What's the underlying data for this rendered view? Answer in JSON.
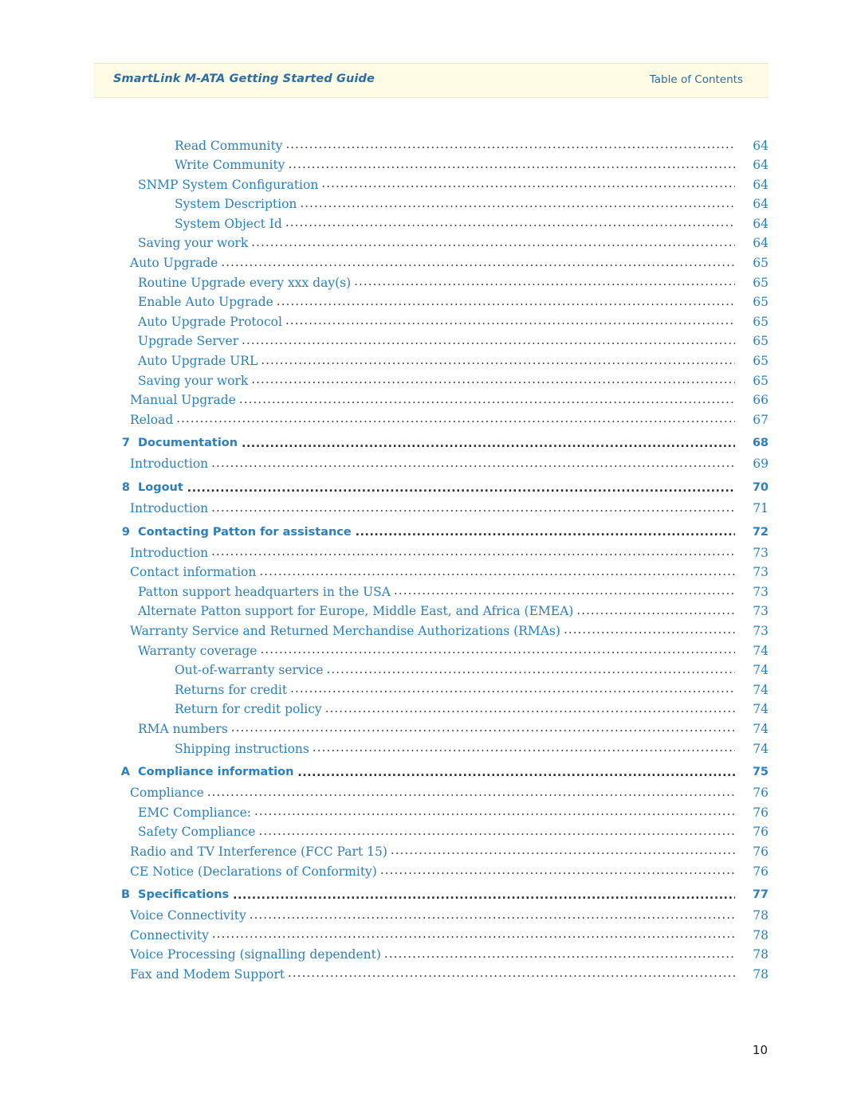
{
  "header": {
    "title": "SmartLink M-ATA Getting Started Guide",
    "section": "Table of Contents"
  },
  "footer": {
    "page_number": "10"
  },
  "toc": {
    "entries": [
      {
        "num": "",
        "label": "Read Community",
        "page": "64",
        "level": 2,
        "chapter": false
      },
      {
        "num": "",
        "label": "Write Community",
        "page": "64",
        "level": 2,
        "chapter": false
      },
      {
        "num": "",
        "label": "SNMP System Configuration",
        "page": "64",
        "level": 1,
        "chapter": false
      },
      {
        "num": "",
        "label": "System Description",
        "page": "64",
        "level": 2,
        "chapter": false
      },
      {
        "num": "",
        "label": "System Object Id",
        "page": "64",
        "level": 2,
        "chapter": false
      },
      {
        "num": "",
        "label": "Saving your work",
        "page": "64",
        "level": 1,
        "chapter": false
      },
      {
        "num": "",
        "label": "Auto Upgrade",
        "page": "65",
        "level": 0,
        "chapter": false
      },
      {
        "num": "",
        "label": "Routine Upgrade every xxx day(s)",
        "page": "65",
        "level": 1,
        "chapter": false
      },
      {
        "num": "",
        "label": "Enable Auto Upgrade",
        "page": "65",
        "level": 1,
        "chapter": false
      },
      {
        "num": "",
        "label": "Auto Upgrade Protocol",
        "page": "65",
        "level": 1,
        "chapter": false
      },
      {
        "num": "",
        "label": "Upgrade Server",
        "page": "65",
        "level": 1,
        "chapter": false
      },
      {
        "num": "",
        "label": "Auto Upgrade URL",
        "page": "65",
        "level": 1,
        "chapter": false
      },
      {
        "num": "",
        "label": "Saving your work",
        "page": "65",
        "level": 1,
        "chapter": false
      },
      {
        "num": "",
        "label": "Manual Upgrade",
        "page": "66",
        "level": 0,
        "chapter": false
      },
      {
        "num": "",
        "label": "Reload",
        "page": "67",
        "level": 0,
        "chapter": false
      },
      {
        "num": "7",
        "label": "Documentation",
        "page": "68",
        "level": 0,
        "chapter": true
      },
      {
        "num": "",
        "label": "Introduction",
        "page": "69",
        "level": 0,
        "chapter": false
      },
      {
        "num": "8",
        "label": "Logout",
        "page": "70",
        "level": 0,
        "chapter": true
      },
      {
        "num": "",
        "label": "Introduction",
        "page": "71",
        "level": 0,
        "chapter": false
      },
      {
        "num": "9",
        "label": "Contacting Patton for assistance",
        "page": "72",
        "level": 0,
        "chapter": true
      },
      {
        "num": "",
        "label": "Introduction",
        "page": "73",
        "level": 0,
        "chapter": false
      },
      {
        "num": "",
        "label": "Contact information",
        "page": "73",
        "level": 0,
        "chapter": false
      },
      {
        "num": "",
        "label": "Patton support headquarters in the USA",
        "page": "73",
        "level": 1,
        "chapter": false
      },
      {
        "num": "",
        "label": "Alternate Patton support for Europe, Middle East, and Africa (EMEA)",
        "page": "73",
        "level": 1,
        "chapter": false
      },
      {
        "num": "",
        "label": "Warranty Service and Returned Merchandise Authorizations (RMAs)",
        "page": "73",
        "level": 0,
        "chapter": false
      },
      {
        "num": "",
        "label": "Warranty coverage",
        "page": "74",
        "level": 1,
        "chapter": false
      },
      {
        "num": "",
        "label": "Out-of-warranty service",
        "page": "74",
        "level": 2,
        "chapter": false
      },
      {
        "num": "",
        "label": "Returns for credit",
        "page": "74",
        "level": 2,
        "chapter": false
      },
      {
        "num": "",
        "label": "Return for credit policy",
        "page": "74",
        "level": 2,
        "chapter": false
      },
      {
        "num": "",
        "label": "RMA numbers",
        "page": "74",
        "level": 1,
        "chapter": false
      },
      {
        "num": "",
        "label": "Shipping instructions",
        "page": "74",
        "level": 2,
        "chapter": false
      },
      {
        "num": "A",
        "label": "Compliance information",
        "page": "75",
        "level": 0,
        "chapter": true
      },
      {
        "num": "",
        "label": "Compliance",
        "page": "76",
        "level": 0,
        "chapter": false
      },
      {
        "num": "",
        "label": "EMC Compliance:",
        "page": "76",
        "level": 1,
        "chapter": false
      },
      {
        "num": "",
        "label": "Safety Compliance",
        "page": "76",
        "level": 1,
        "chapter": false
      },
      {
        "num": "",
        "label": "Radio and TV Interference (FCC Part 15)",
        "page": "76",
        "level": 0,
        "chapter": false
      },
      {
        "num": "",
        "label": "CE Notice (Declarations of Conformity)",
        "page": "76",
        "level": 0,
        "chapter": false
      },
      {
        "num": "B",
        "label": "Specifications",
        "page": "77",
        "level": 0,
        "chapter": true
      },
      {
        "num": "",
        "label": "Voice Connectivity",
        "page": "78",
        "level": 0,
        "chapter": false
      },
      {
        "num": "",
        "label": "Connectivity",
        "page": "78",
        "level": 0,
        "chapter": false
      },
      {
        "num": "",
        "label": "Voice Processing (signalling dependent)",
        "page": "78",
        "level": 0,
        "chapter": false
      },
      {
        "num": "",
        "label": "Fax and Modem Support",
        "page": "78",
        "level": 0,
        "chapter": false
      }
    ]
  }
}
